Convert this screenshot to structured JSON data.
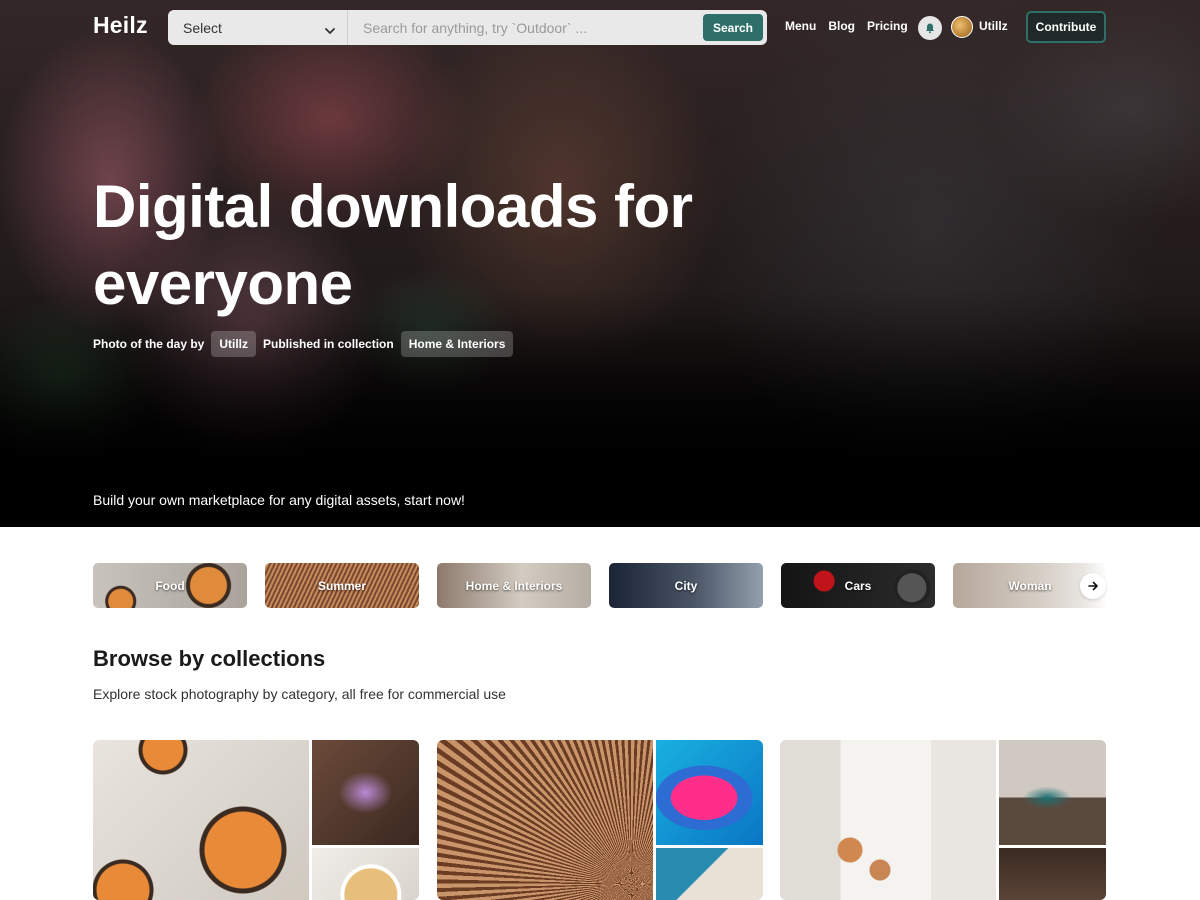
{
  "brand": {
    "logo": "Heilz"
  },
  "search": {
    "select_value": "Select",
    "placeholder": "Search for anything, try `Outdoor` ...",
    "button_label": "Search"
  },
  "nav": {
    "links": [
      {
        "label": "Menu"
      },
      {
        "label": "Blog"
      },
      {
        "label": "Pricing"
      }
    ],
    "username": "Utillz",
    "contribute_label": "Contribute"
  },
  "hero": {
    "title": "Digital downloads for everyone",
    "photo_by_prefix": "Photo of the day by",
    "photo_author": "Utillz",
    "published_prefix": "Published in collection",
    "collection_name": "Home & Interiors",
    "tagline": "Build your own marketplace for any digital assets, start now!"
  },
  "categories": [
    {
      "label": "Food"
    },
    {
      "label": "Summer"
    },
    {
      "label": "Home & Interiors"
    },
    {
      "label": "City"
    },
    {
      "label": "Cars"
    },
    {
      "label": "Woman"
    }
  ],
  "collections": {
    "title": "Browse by collections",
    "subtitle": "Explore stock photography by category, all free for commercial use"
  },
  "colors": {
    "accent": "#2f6f6a",
    "hero_bg": "#000000",
    "page_bg": "#ffffff"
  },
  "icons": {
    "select_arrow": "chevron-down-icon",
    "notifications": "bell-icon",
    "carousel_next": "arrow-right-icon"
  }
}
